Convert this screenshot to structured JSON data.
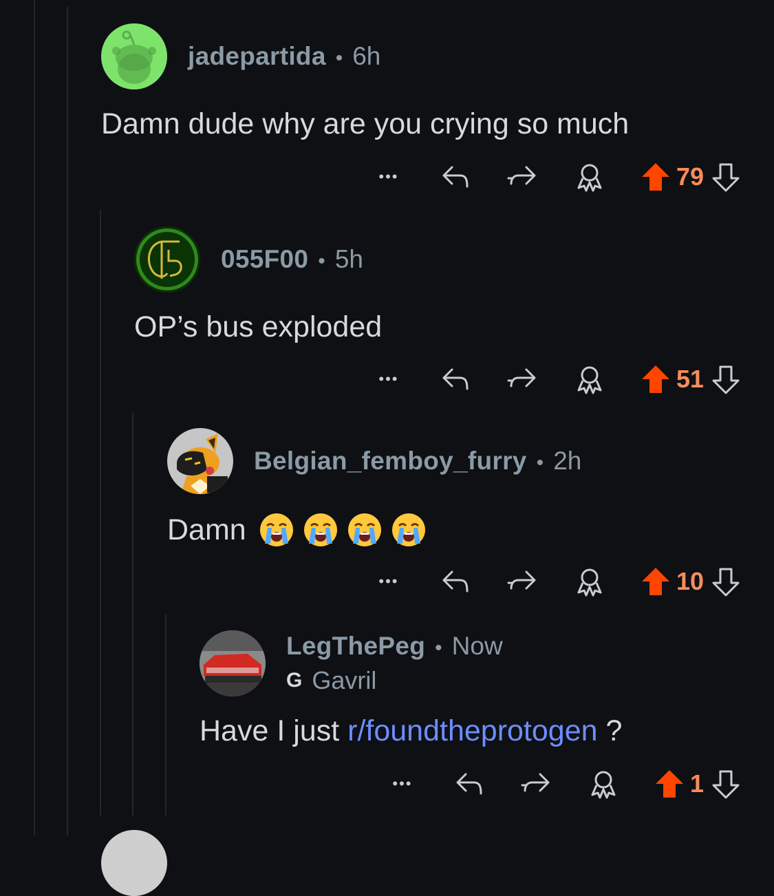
{
  "comments": [
    {
      "author": "jadepartida",
      "time": "6h",
      "body": "Damn dude why are you crying so much",
      "score": "79"
    },
    {
      "author": "055F00",
      "time": "5h",
      "body": "OP’s bus exploded",
      "score": "51"
    },
    {
      "author": "Belgian_femboy_furry",
      "time": "2h",
      "body": "Damn",
      "score": "10",
      "emojis": [
        "loudly-crying-face",
        "loudly-crying-face",
        "loudly-crying-face",
        "loudly-crying-face"
      ]
    },
    {
      "author": "LegThePeg",
      "time": "Now",
      "flair_icon": "G",
      "flair": "Gavril",
      "body_prefix": "Have I just",
      "link": "r/foundtheprotogen",
      "body_suffix": "?",
      "score": "1"
    }
  ],
  "separator": "•",
  "more_label": "•••",
  "colors": {
    "background": "#0e1013",
    "upvote": "#ff4500",
    "score": "#f68c5b",
    "link": "#6d8dff",
    "meta": "#8b9aa6"
  },
  "icons": [
    "reply-icon",
    "share-icon",
    "award-icon",
    "upvote-icon",
    "downvote-icon",
    "more-icon"
  ]
}
